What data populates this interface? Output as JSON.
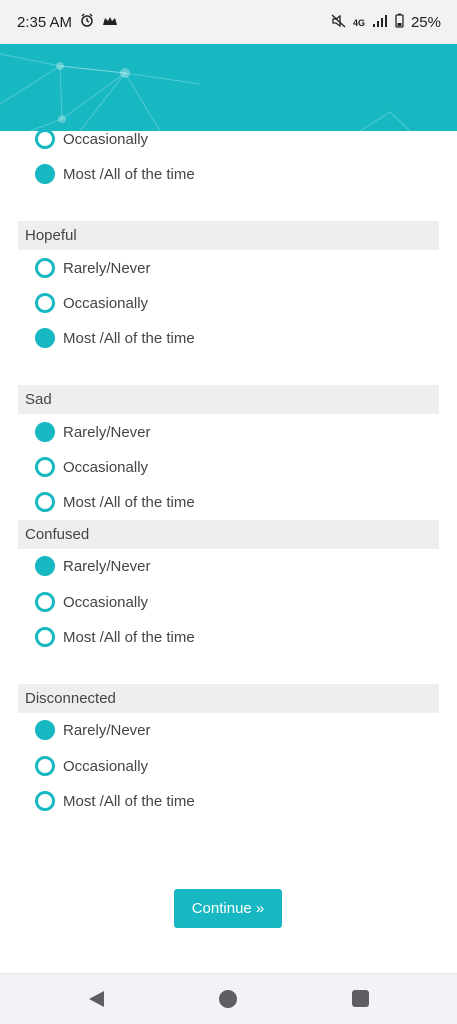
{
  "status": {
    "time": "2:35 AM",
    "battery": "25%",
    "network": "4G"
  },
  "accent_color": "#17b8c2",
  "sections": [
    {
      "title": "",
      "options": [
        {
          "label": "Occasionally",
          "checked": false
        },
        {
          "label": "Most /All of the time",
          "checked": true
        }
      ]
    },
    {
      "title": "Hopeful",
      "options": [
        {
          "label": "Rarely/Never",
          "checked": false
        },
        {
          "label": "Occasionally",
          "checked": false
        },
        {
          "label": "Most /All of the time",
          "checked": true
        }
      ]
    },
    {
      "title": "Sad",
      "options": [
        {
          "label": "Rarely/Never",
          "checked": true
        },
        {
          "label": "Occasionally",
          "checked": false
        },
        {
          "label": "Most /All of the time",
          "checked": false
        }
      ]
    },
    {
      "title": "Confused",
      "options": [
        {
          "label": "Rarely/Never",
          "checked": true
        },
        {
          "label": "Occasionally",
          "checked": false
        },
        {
          "label": "Most /All of the time",
          "checked": false
        }
      ]
    },
    {
      "title": "Disconnected",
      "options": [
        {
          "label": "Rarely/Never",
          "checked": true
        },
        {
          "label": "Occasionally",
          "checked": false
        },
        {
          "label": "Most /All of the time",
          "checked": false
        }
      ]
    }
  ],
  "continue_label": "Continue »",
  "icons": {
    "status": [
      "alarm-icon",
      "notification-icon",
      "mute-icon",
      "network-4g-icon",
      "signal-icon",
      "battery-icon"
    ],
    "nav": [
      "back-icon",
      "home-icon",
      "recents-icon"
    ]
  }
}
